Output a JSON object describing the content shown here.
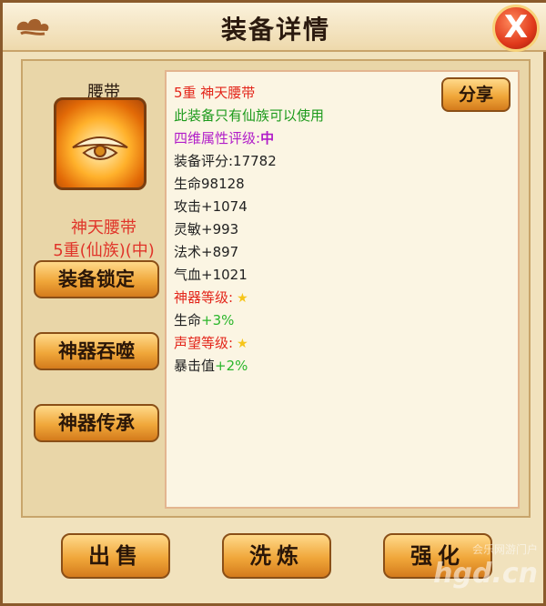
{
  "window": {
    "title": "装备详情",
    "close_label": "X"
  },
  "item": {
    "slot_name": "腰带",
    "name": "神天腰带",
    "subtitle": "5重(仙族)(中)",
    "icon": "belt-item-icon"
  },
  "side_buttons": {
    "lock": "装备锁定",
    "devour": "神器吞噬",
    "inherit": "神器传承"
  },
  "details": {
    "share_label": "分享",
    "lines": [
      {
        "text": "5重  神天腰带",
        "color": "#e3261b"
      },
      {
        "text": "此装备只有仙族可以使用",
        "color": "#1b9a1b"
      },
      {
        "label": "四维属性评级:",
        "value": "中",
        "color": "#b11dc9"
      },
      {
        "text": "装备评分:17782"
      },
      {
        "text": "生命98128"
      },
      {
        "text": "攻击+1074"
      },
      {
        "text": "灵敏+993"
      },
      {
        "text": "法术+897"
      },
      {
        "text": "气血+1021"
      },
      {
        "label": "神器等级:",
        "icon": "star-icon",
        "color": "#e3261b"
      },
      {
        "label": "生命",
        "value": "+3%"
      },
      {
        "label": "声望等级:",
        "icon": "star-icon",
        "color": "#e3261b"
      },
      {
        "label": "暴击值",
        "value": "+2%"
      }
    ]
  },
  "bottom_buttons": {
    "sell": "出售",
    "wash": "洗炼",
    "strengthen": "强化"
  },
  "watermark": {
    "line1": "会乐网游门户",
    "line2": "hgd.cn"
  }
}
